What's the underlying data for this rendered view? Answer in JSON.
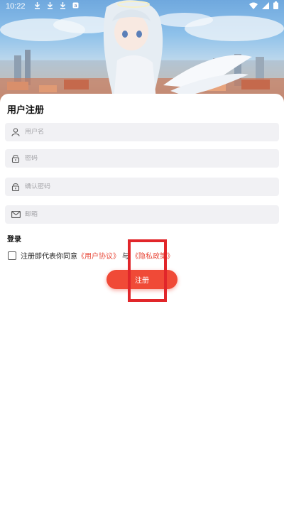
{
  "status_bar": {
    "time": "10:22",
    "left_icons": [
      "download-icon",
      "download-icon",
      "download-icon",
      "app-icon"
    ],
    "right_icons": [
      "wifi-icon",
      "signal-icon",
      "battery-icon"
    ]
  },
  "form": {
    "title": "用户注册",
    "fields": [
      {
        "icon": "user-icon",
        "placeholder": "用户名"
      },
      {
        "icon": "lock-icon",
        "placeholder": "密码"
      },
      {
        "icon": "lock-icon",
        "placeholder": "确认密码"
      },
      {
        "icon": "mail-icon",
        "placeholder": "邮箱"
      }
    ],
    "login_link": "登录",
    "agreement": {
      "prefix": "注册即代表你同意",
      "user_agreement": "《用户协议》",
      "and": "与",
      "privacy_policy": "《隐私政策》"
    },
    "register_button": "注册"
  },
  "colors": {
    "accent": "#f04a37",
    "link": "#e84b3c",
    "field_bg": "#f1f1f4",
    "highlight": "#e1262a"
  }
}
